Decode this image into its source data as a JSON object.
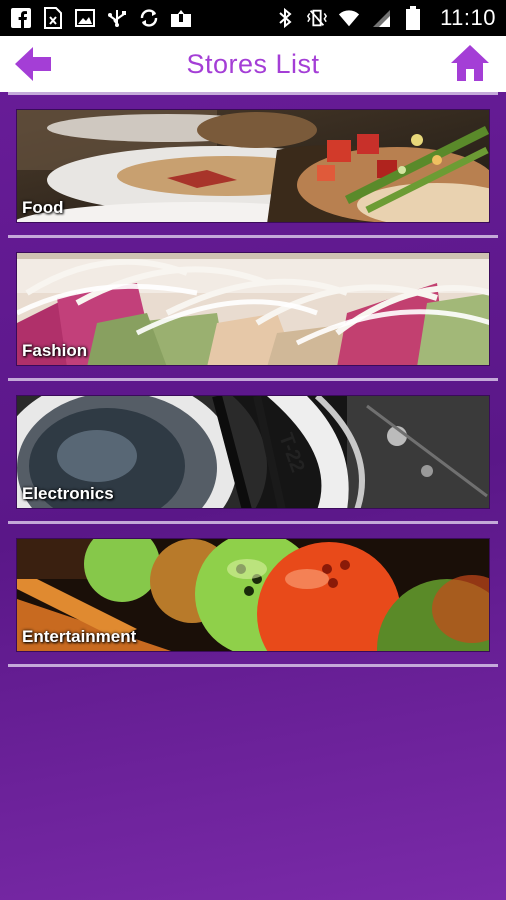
{
  "status_bar": {
    "time": "11:10",
    "left_icons": [
      "facebook-icon",
      "sim-icon",
      "image-icon",
      "usb-icon",
      "sync-icon",
      "upload-icon"
    ],
    "right_icons": [
      "bluetooth-icon",
      "vibrate-icon",
      "wifi-icon",
      "signal-icon",
      "battery-icon"
    ]
  },
  "header": {
    "title": "Stores List",
    "back_icon": "arrow-left-icon",
    "home_icon": "home-icon",
    "accent_color": "#a43ed6"
  },
  "stores": [
    {
      "label": "Food",
      "image": "food-image"
    },
    {
      "label": "Fashion",
      "image": "fashion-image"
    },
    {
      "label": "Electronics",
      "image": "electronics-image"
    },
    {
      "label": "Entertainment",
      "image": "entertainment-image"
    }
  ],
  "colors": {
    "background": "#6a1d9a",
    "header_background": "#ffffff",
    "divider": "#d6c3e6"
  }
}
